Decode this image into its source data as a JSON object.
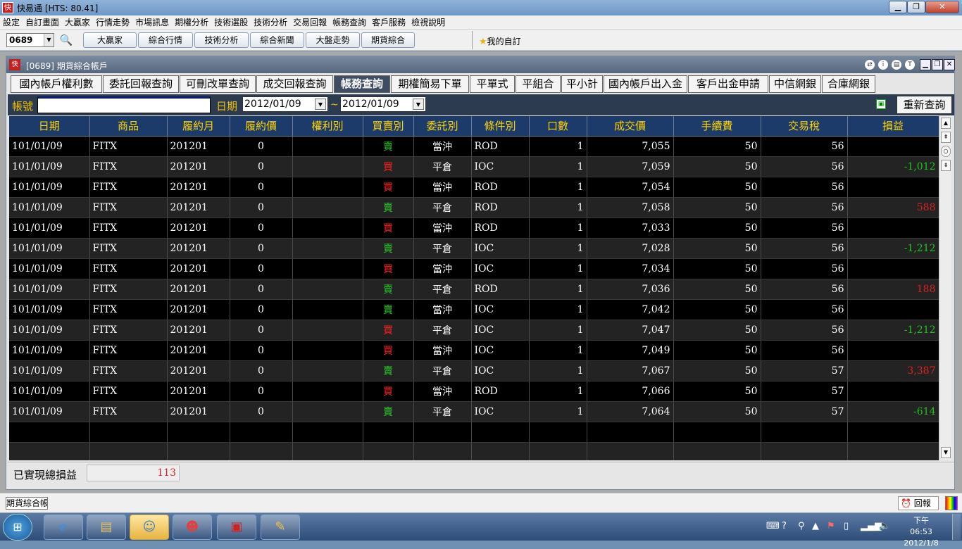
{
  "app": {
    "title": "快易通 [HTS: 80.41]"
  },
  "menu": [
    "設定",
    "自訂畫面",
    "大贏家",
    "行情走勢",
    "市場訊息",
    "期權分析",
    "技術選股",
    "技術分析",
    "交易回報",
    "帳務查詢",
    "客戶服務",
    "檢視說明"
  ],
  "toolbar": {
    "stock_code": "0689",
    "buttons": [
      "大贏家",
      "綜合行情",
      "技術分析",
      "綜合新聞",
      "大盤走勢",
      "期貨綜合"
    ],
    "favorite_label": "我的自訂"
  },
  "window": {
    "title": "[0689] 期貨綜合帳戶",
    "tabs": [
      "國內帳戶權利數",
      "委託回報查詢",
      "可刪改單查詢",
      "成交回報查詢",
      "帳務查詢",
      "期權簡易下單",
      "平單式",
      "平組合",
      "平小計",
      "國內帳戶出入金",
      "客戶出金申請",
      "中信網銀",
      "合庫網銀"
    ],
    "active_tab": "帳務查詢"
  },
  "filter": {
    "account_label": "帳號",
    "account_value": "",
    "date_label": "日期",
    "date_from": "2012/01/09",
    "date_sep": "~",
    "date_to": "2012/01/09",
    "requery_label": "重新查詢"
  },
  "table": {
    "columns": [
      "日期",
      "商品",
      "履約月",
      "履約價",
      "權利別",
      "買賣別",
      "委託別",
      "條件別",
      "口數",
      "成交價",
      "手續費",
      "交易稅",
      "損益"
    ],
    "rows": [
      [
        "101/01/09",
        "FITX",
        "201201",
        "0",
        "",
        "賣",
        "當沖",
        "ROD",
        "1",
        "7,055",
        "50",
        "56",
        ""
      ],
      [
        "101/01/09",
        "FITX",
        "201201",
        "0",
        "",
        "買",
        "平倉",
        "IOC",
        "1",
        "7,059",
        "50",
        "56",
        "-1,012"
      ],
      [
        "101/01/09",
        "FITX",
        "201201",
        "0",
        "",
        "買",
        "當沖",
        "ROD",
        "1",
        "7,054",
        "50",
        "56",
        ""
      ],
      [
        "101/01/09",
        "FITX",
        "201201",
        "0",
        "",
        "賣",
        "平倉",
        "ROD",
        "1",
        "7,058",
        "50",
        "56",
        "588"
      ],
      [
        "101/01/09",
        "FITX",
        "201201",
        "0",
        "",
        "買",
        "當沖",
        "ROD",
        "1",
        "7,033",
        "50",
        "56",
        ""
      ],
      [
        "101/01/09",
        "FITX",
        "201201",
        "0",
        "",
        "賣",
        "平倉",
        "IOC",
        "1",
        "7,028",
        "50",
        "56",
        "-1,212"
      ],
      [
        "101/01/09",
        "FITX",
        "201201",
        "0",
        "",
        "買",
        "當沖",
        "IOC",
        "1",
        "7,034",
        "50",
        "56",
        ""
      ],
      [
        "101/01/09",
        "FITX",
        "201201",
        "0",
        "",
        "賣",
        "平倉",
        "ROD",
        "1",
        "7,036",
        "50",
        "56",
        "188"
      ],
      [
        "101/01/09",
        "FITX",
        "201201",
        "0",
        "",
        "賣",
        "當沖",
        "IOC",
        "1",
        "7,042",
        "50",
        "56",
        ""
      ],
      [
        "101/01/09",
        "FITX",
        "201201",
        "0",
        "",
        "買",
        "平倉",
        "IOC",
        "1",
        "7,047",
        "50",
        "56",
        "-1,212"
      ],
      [
        "101/01/09",
        "FITX",
        "201201",
        "0",
        "",
        "買",
        "當沖",
        "IOC",
        "1",
        "7,049",
        "50",
        "56",
        ""
      ],
      [
        "101/01/09",
        "FITX",
        "201201",
        "0",
        "",
        "賣",
        "平倉",
        "IOC",
        "1",
        "7,067",
        "50",
        "57",
        "3,387"
      ],
      [
        "101/01/09",
        "FITX",
        "201201",
        "0",
        "",
        "買",
        "當沖",
        "ROD",
        "1",
        "7,066",
        "50",
        "57",
        ""
      ],
      [
        "101/01/09",
        "FITX",
        "201201",
        "0",
        "",
        "賣",
        "平倉",
        "IOC",
        "1",
        "7,064",
        "50",
        "57",
        "-614"
      ],
      [
        "",
        "",
        "",
        "",
        "",
        "",
        "",
        "",
        "",
        "",
        "",
        "",
        ""
      ],
      [
        "",
        "",
        "",
        "",
        "",
        "",
        "",
        "",
        "",
        "",
        "",
        "",
        ""
      ]
    ]
  },
  "summary": {
    "label": "已實現總損益",
    "value": "113"
  },
  "status": {
    "window_tab": "期貨綜合帳戶",
    "report_label": "回報"
  },
  "clock": {
    "time": "下午 06:53",
    "date": "2012/1/8"
  },
  "colors": {
    "sell": "#28c828",
    "buy": "#ff2020",
    "profit": "#e02020",
    "loss": "#20c020",
    "header_bg": "#1c3b6b",
    "header_text": "#ffd500"
  }
}
